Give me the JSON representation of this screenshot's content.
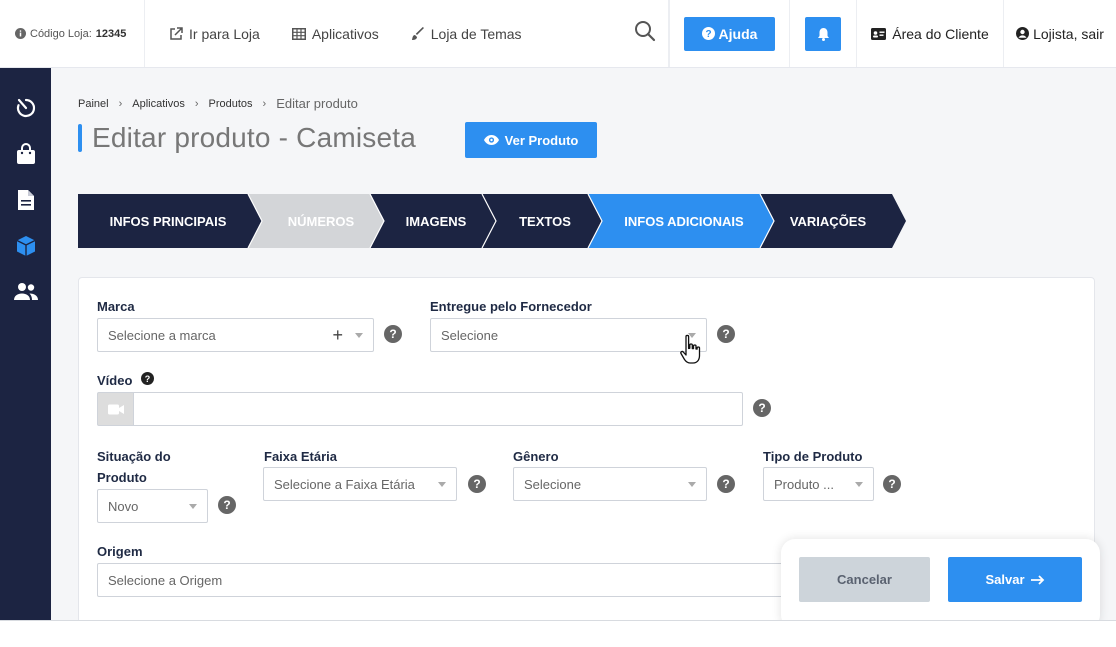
{
  "colors": {
    "accent": "#2d8ff0",
    "sidebar": "#1c2442",
    "step_done": "#d3d5d8",
    "step_active": "#2d8ff0",
    "step_default": "#1c2442"
  },
  "topbar": {
    "store_code_label": "Código Loja:",
    "store_code_value": "12345",
    "links": [
      {
        "label": "Ir para Loja",
        "icon": "external-link-icon"
      },
      {
        "label": "Aplicativos",
        "icon": "grid-icon"
      },
      {
        "label": "Loja de Temas",
        "icon": "brush-icon"
      }
    ],
    "help_label": "Ajuda",
    "client_area_label": "Área do Cliente",
    "logout_label": "Lojista, sair"
  },
  "sidebar": {
    "items": [
      {
        "icon": "speedometer-icon"
      },
      {
        "icon": "shopping-bag-icon"
      },
      {
        "icon": "document-icon"
      },
      {
        "icon": "cube-icon"
      },
      {
        "icon": "users-icon"
      }
    ]
  },
  "breadcrumb": [
    "Painel",
    "Aplicativos",
    "Produtos",
    "Editar produto"
  ],
  "page": {
    "title": "Editar produto - Camiseta",
    "view_button": "Ver Produto"
  },
  "steps": [
    {
      "label": "INFOS PRINCIPAIS",
      "state": "default"
    },
    {
      "label": "NÚMEROS",
      "state": "done"
    },
    {
      "label": "IMAGENS",
      "state": "default"
    },
    {
      "label": "TEXTOS",
      "state": "default"
    },
    {
      "label": "INFOS ADICIONAIS",
      "state": "active"
    },
    {
      "label": "VARIAÇÕES",
      "state": "default"
    }
  ],
  "form": {
    "marca": {
      "label": "Marca",
      "placeholder": "Selecione a marca"
    },
    "fornecedor": {
      "label": "Entregue pelo Fornecedor",
      "placeholder": "Selecione"
    },
    "video": {
      "label": "Vídeo",
      "value": ""
    },
    "situacao": {
      "label": "Situação do Produto",
      "value": "Novo"
    },
    "faixa": {
      "label": "Faixa Etária",
      "placeholder": "Selecione a Faixa Etária"
    },
    "genero": {
      "label": "Gênero",
      "placeholder": "Selecione"
    },
    "tipo": {
      "label": "Tipo de Produto",
      "value": "Produto ..."
    },
    "origem": {
      "label": "Origem",
      "placeholder": "Selecione a Origem"
    },
    "help_glyph": "?"
  },
  "actions": {
    "cancel": "Cancelar",
    "save": "Salvar"
  }
}
